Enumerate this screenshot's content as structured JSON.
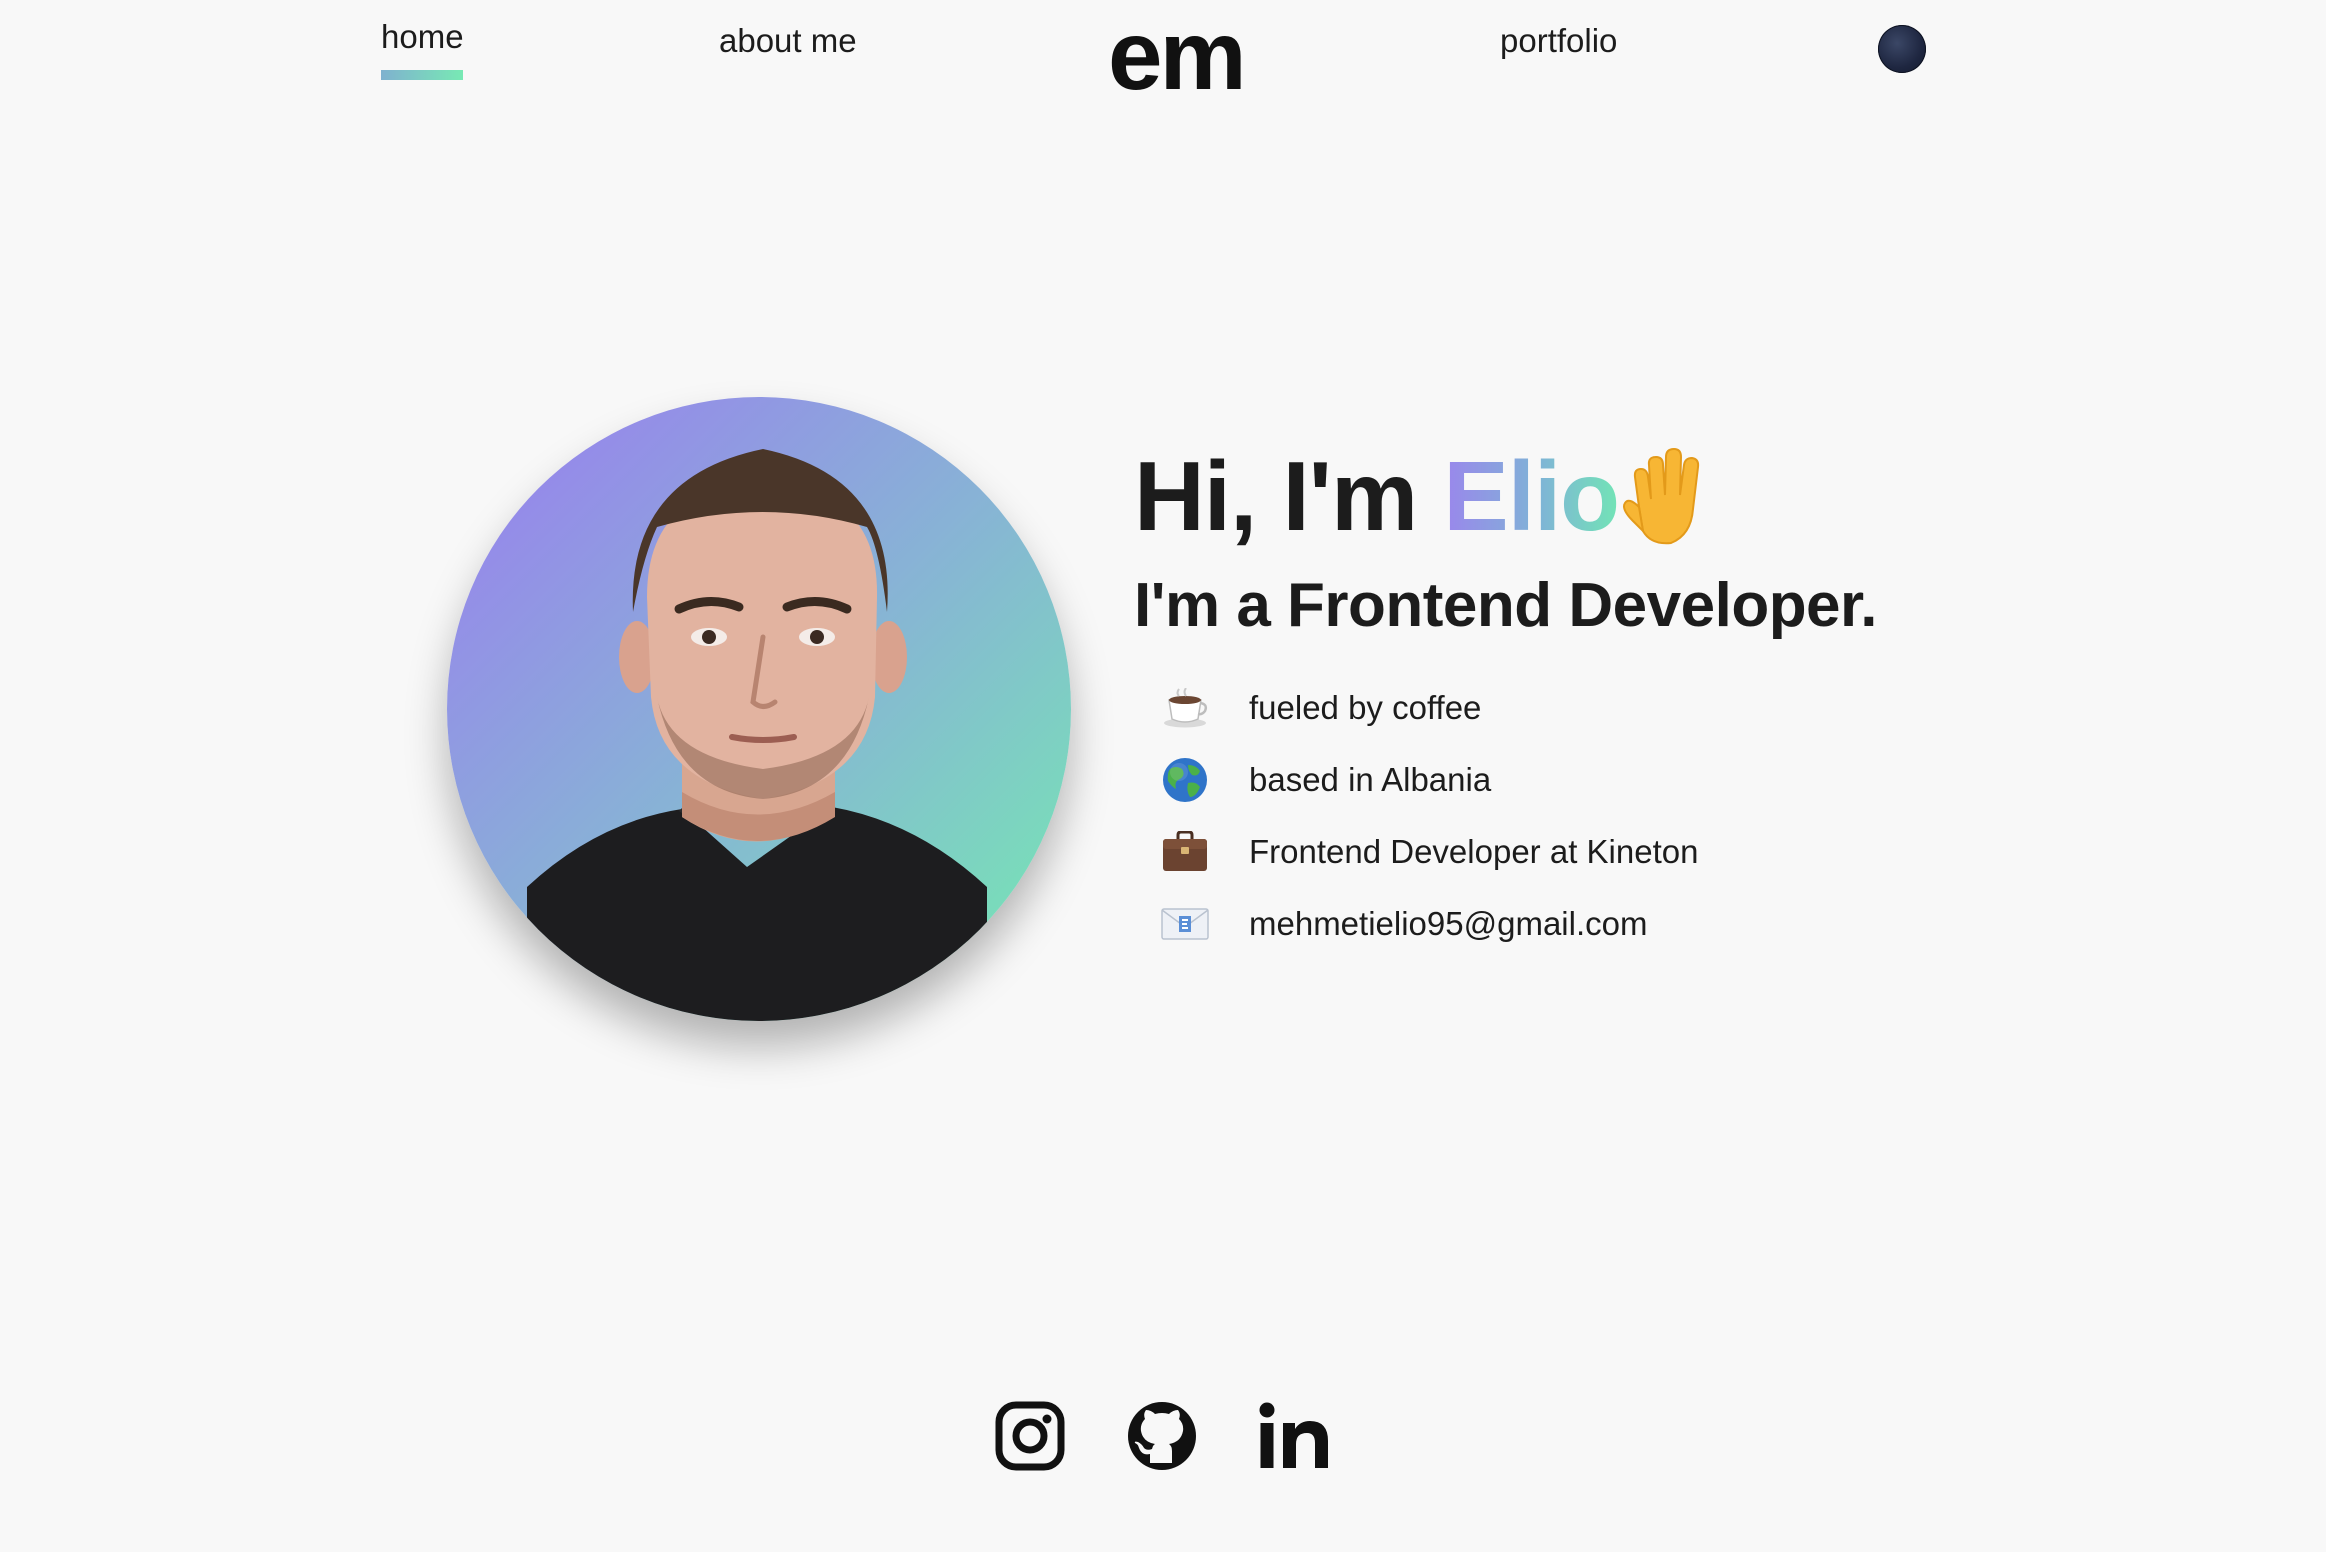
{
  "nav": {
    "home_label": "home",
    "about_label": "about me",
    "logo_text": "em",
    "portfolio_label": "portfolio",
    "active_tab": "home",
    "theme_toggle_icon": "moon-icon"
  },
  "hero": {
    "greeting_prefix": "Hi, I'm ",
    "name": "Elio",
    "wave_icon": "raised-hand-icon",
    "role": "I'm a Frontend Developer.",
    "facts": [
      {
        "icon": "coffee-icon",
        "text": "fueled by coffee"
      },
      {
        "icon": "globe-icon",
        "text": "based in Albania"
      },
      {
        "icon": "briefcase-icon",
        "text": "Frontend Developer at Kineton"
      },
      {
        "icon": "email-icon",
        "text": "mehmetielio95@gmail.com"
      }
    ]
  },
  "socials": [
    {
      "icon": "instagram-icon"
    },
    {
      "icon": "github-icon"
    },
    {
      "icon": "linkedin-icon"
    }
  ],
  "colors": {
    "background": "#f8f8f8",
    "text": "#1c1c1c",
    "gradient_start": "#9a7cf0",
    "gradient_end": "#74ecb0",
    "toggle": "#1e2640"
  }
}
